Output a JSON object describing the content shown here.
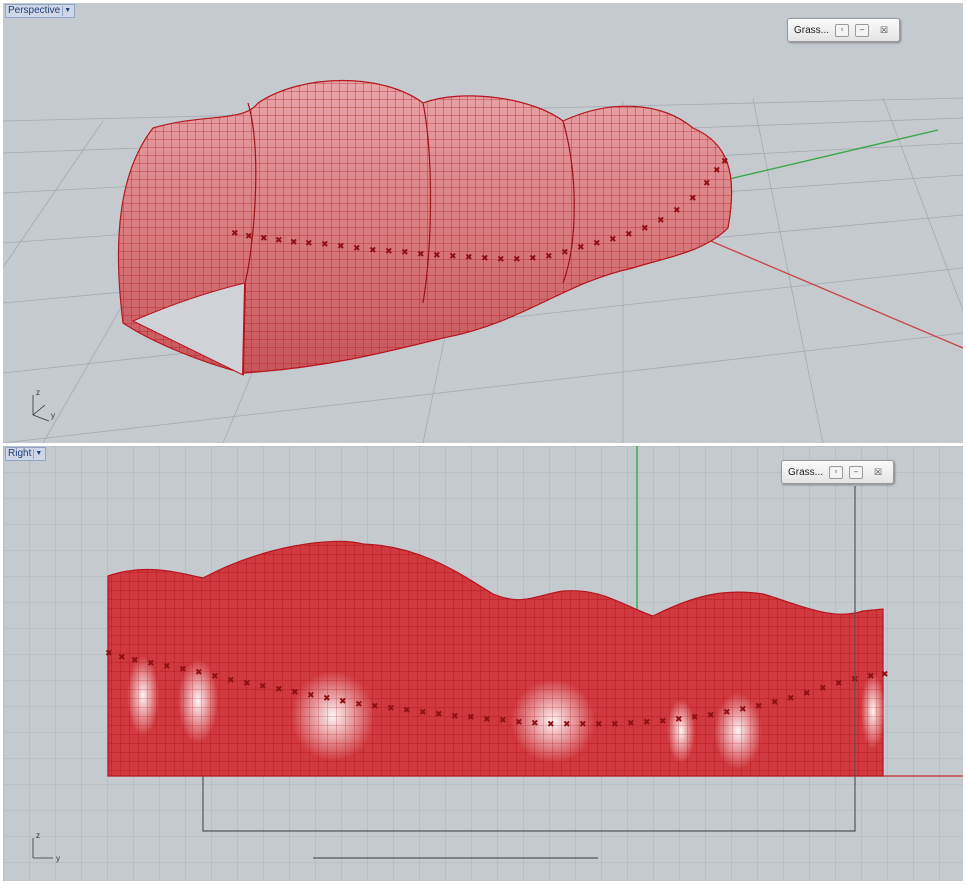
{
  "viewports": {
    "perspective": {
      "label": "Perspective"
    },
    "right": {
      "label": "Right"
    }
  },
  "panel_top": {
    "title": "Grass...",
    "close": "☒"
  },
  "panel_bottom": {
    "title": "Grass...",
    "close": "☒"
  },
  "axes_top": {
    "z": "z",
    "y": "y"
  },
  "axes_bottom": {
    "z": "z",
    "y": "y"
  },
  "colors": {
    "viewport_bg": "#c5cacf",
    "grid": "#9ea5ad",
    "surface": "#d0393f",
    "mesh": "#b5161d",
    "x_axis": "#c8484a",
    "y_axis": "#3aa84a"
  }
}
